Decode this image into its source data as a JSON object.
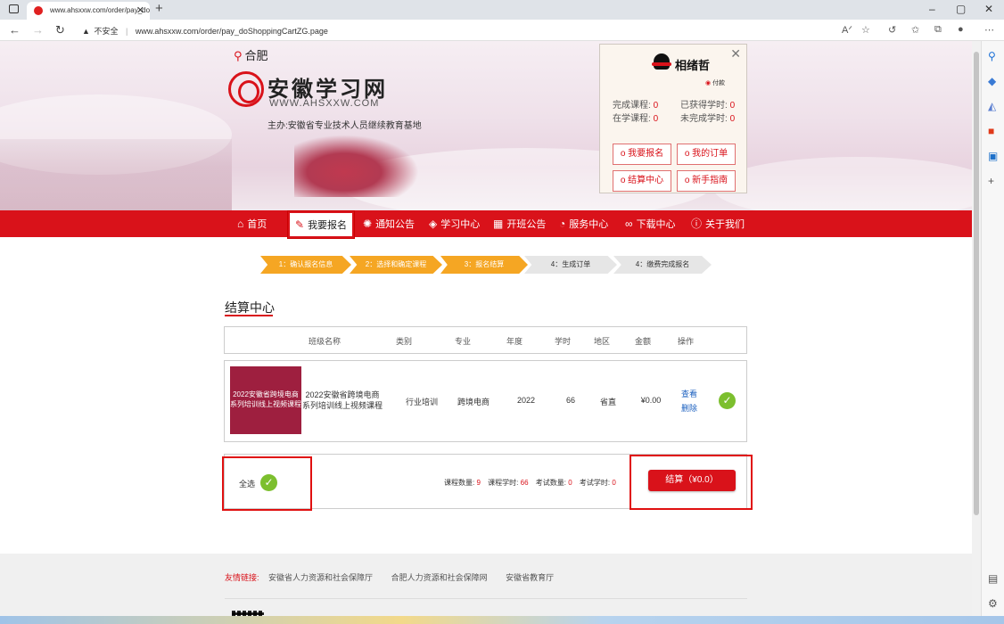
{
  "browser": {
    "tab_title": "www.ahsxxw.com/order/pay_do",
    "tab_close": "✕",
    "new_tab": "+",
    "security_label": "不安全",
    "url": "www.ahsxxw.com/order/pay_doShoppingCartZG.page",
    "window_controls": [
      "–",
      "▢",
      "✕"
    ]
  },
  "header": {
    "location": "合肥",
    "site_title": "安徽学习网",
    "site_url": "WWW.AHSXXW.COM",
    "host": "主办:安徽省专业技术人员继续教育基地"
  },
  "user_panel": {
    "close": "✕",
    "name": "相绪哲",
    "pay_label": "付款",
    "stats": [
      {
        "label": "完成课程:",
        "value": "0"
      },
      {
        "label": "已获得学时:",
        "value": "0"
      },
      {
        "label": "在学课程:",
        "value": "0"
      },
      {
        "label": "未完成学时:",
        "value": "0"
      }
    ],
    "buttons": [
      "o 我要报名",
      "o 我的订单",
      "o 结算中心",
      "o 新手指南"
    ]
  },
  "nav": {
    "items": [
      {
        "label": "首页",
        "icon": "home-icon"
      },
      {
        "label": "我要报名",
        "icon": "edit-icon"
      },
      {
        "label": "通知公告",
        "icon": "news-icon"
      },
      {
        "label": "学习中心",
        "icon": "graduation-cap-icon"
      },
      {
        "label": "开班公告",
        "icon": "calendar-icon"
      },
      {
        "label": "服务中心",
        "icon": "service-icon"
      },
      {
        "label": "下载中心",
        "icon": "link-icon"
      },
      {
        "label": "关于我们",
        "icon": "info-icon"
      }
    ]
  },
  "steps": [
    {
      "label": "1：确认报名信息",
      "active": true
    },
    {
      "label": "2：选择和确定课程",
      "active": true
    },
    {
      "label": "3：报名结算",
      "active": true
    },
    {
      "label": "4：生成订单",
      "active": false
    },
    {
      "label": "4：缴费完成报名",
      "active": false
    }
  ],
  "section_title": "结算中心",
  "table": {
    "headers": [
      "班级名称",
      "类别",
      "专业",
      "年度",
      "学时",
      "地区",
      "金额",
      "操作"
    ],
    "rows": [
      {
        "thumb_text": "2022安徽省跨境电商系列培训线上视频课程",
        "name": "2022安徽省跨境电商系列培训线上视频课程",
        "category": "行业培训",
        "major": "跨境电商",
        "year": "2022",
        "hours": "66",
        "region": "省直",
        "amount": "¥0.00",
        "action_view": "查看",
        "action_delete": "删除"
      }
    ]
  },
  "footer_summary": {
    "select_all": "全选",
    "course_count_label": "课程数量:",
    "course_count": "9",
    "course_hours_label": "课程学时:",
    "course_hours": "66",
    "exam_count_label": "考试数量:",
    "exam_count": "0",
    "exam_hours_label": "考试学时:",
    "exam_hours": "0",
    "settle_button": "结算（¥0.0）"
  },
  "friend_links": {
    "label": "友情链接:",
    "links": [
      "安徽省人力资源和社会保障厅",
      "合肥人力资源和社会保障网",
      "安徽省教育厅"
    ]
  },
  "colors": {
    "brand_red": "#d9121a",
    "step_active": "#f5a623",
    "check_green": "#7cbf2e"
  }
}
